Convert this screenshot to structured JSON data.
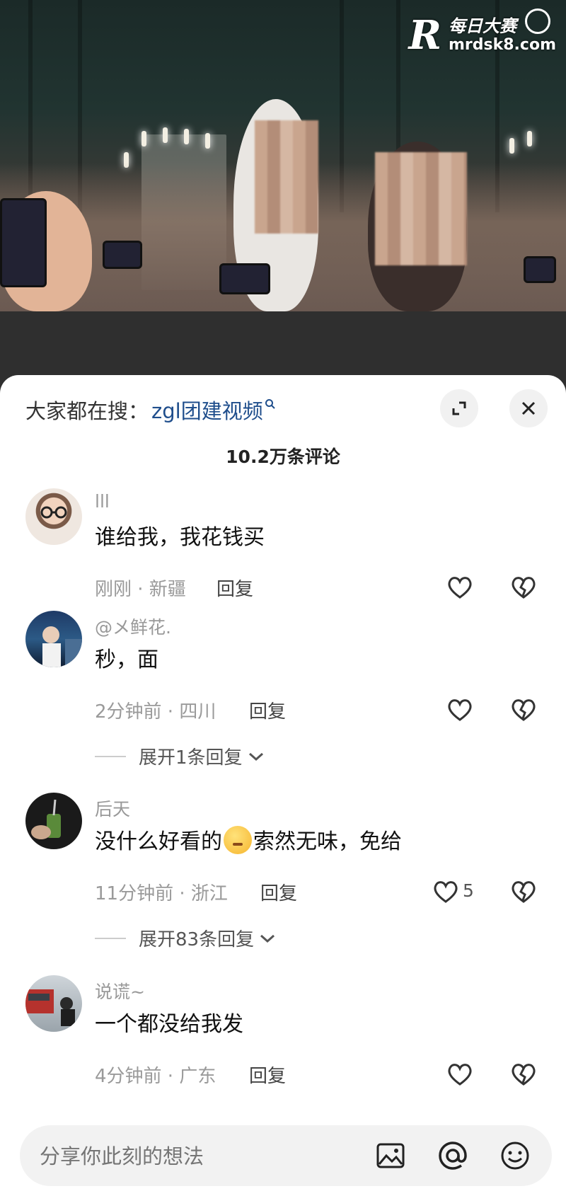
{
  "watermark": {
    "logo": "R",
    "name": "每日大赛",
    "url": "mrdsk8.com"
  },
  "sheet": {
    "search_prefix": "大家都在搜：",
    "search_keyword": "zgl团建视频",
    "expand_icon": "expand-icon",
    "close_icon": "close-icon",
    "comment_count": "10.2万条评论"
  },
  "comments": [
    {
      "user": "lll",
      "text": "谁给我，我花钱买",
      "time_loc": "刚刚 · 新疆",
      "reply": "回复",
      "likes": ""
    },
    {
      "user": "@メ鲜花.",
      "text": "秒，面",
      "time_loc": "2分钟前 · 四川",
      "reply": "回复",
      "likes": "",
      "expand": "展开1条回复"
    },
    {
      "user": "后天",
      "text_before": "没什么好看的",
      "text_after": "索然无味，免给",
      "time_loc": "11分钟前 · 浙江",
      "reply": "回复",
      "likes": "5",
      "expand": "展开83条回复"
    },
    {
      "user": "说谎~",
      "text": "一个都没给我发",
      "time_loc": "4分钟前 · 广东",
      "reply": "回复",
      "likes": ""
    }
  ],
  "input": {
    "placeholder": "分享你此刻的想法"
  }
}
